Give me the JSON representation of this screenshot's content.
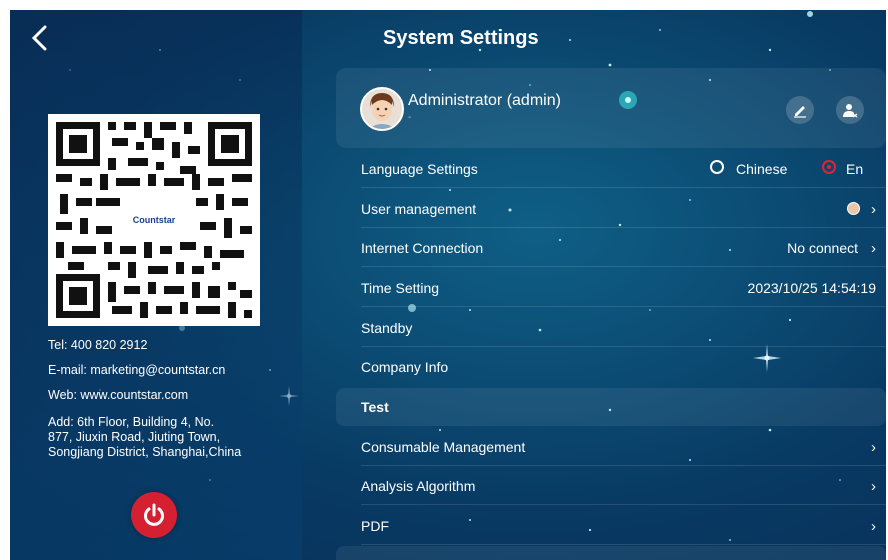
{
  "header": {
    "title": "System Settings"
  },
  "left": {
    "qr_logo": "Countstar",
    "tel": "Tel: 400 820 2912",
    "email": "E-mail: marketing@countstar.cn",
    "web": "Web: www.countstar.com",
    "address": "Add: 6th Floor, Building 4, No.\n877, Jiuxin Road, Jiuting Town,\nSongjiang District, Shanghai,China"
  },
  "user": {
    "name": "Administrator (admin)",
    "sub": "-"
  },
  "settings": {
    "language": {
      "label": "Language Settings",
      "option_chinese": "Chinese",
      "option_en": "En",
      "selected": "En"
    },
    "user_management": {
      "label": "User management"
    },
    "internet": {
      "label": "Internet Connection",
      "value": "No connect"
    },
    "time": {
      "label": "Time Setting",
      "value": "2023/10/25 14:54:19"
    },
    "standby": {
      "label": "Standby"
    },
    "company": {
      "label": "Company Info"
    },
    "test": {
      "label": "Test"
    },
    "consumable": {
      "label": "Consumable Management"
    },
    "algorithm": {
      "label": "Analysis Algorithm"
    },
    "pdf": {
      "label": "PDF"
    }
  },
  "icons": {
    "back": "chevron-left-icon",
    "edit": "edit-user-icon",
    "logout": "logout-user-icon",
    "power": "power-icon",
    "chevron": "chevron-right-icon"
  },
  "colors": {
    "accent_red": "#e52233",
    "power_red": "#d42030"
  }
}
